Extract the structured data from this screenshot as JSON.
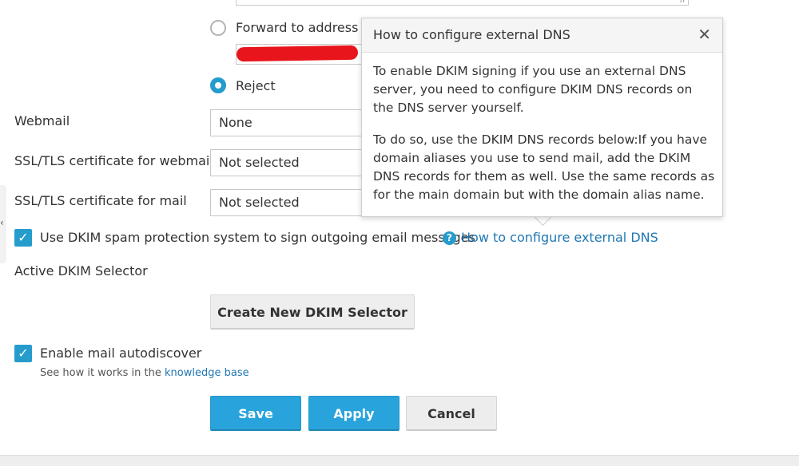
{
  "mail_forwarding": {
    "forward_label": "Forward to address",
    "reject_label": "Reject",
    "selected": "reject"
  },
  "fields": {
    "webmail_label": "Webmail",
    "webmail_value": "None",
    "ssl_webmail_label": "SSL/TLS certificate for webmail",
    "ssl_webmail_value": "Not selected",
    "ssl_mail_label": "SSL/TLS certificate for mail",
    "ssl_mail_value": "Not selected"
  },
  "dkim": {
    "checkbox_label": "Use DKIM spam protection system to sign outgoing email messages",
    "checked": true,
    "help_icon": "question-circle-icon",
    "help_link": "How to configure external DNS",
    "selector_label": "Active DKIM Selector",
    "create_button": "Create New DKIM Selector"
  },
  "autodiscover": {
    "checkbox_label": "Enable mail autodiscover",
    "checked": true,
    "hint_prefix": "See how it works in the",
    "hint_link": "knowledge base"
  },
  "actions": {
    "save": "Save",
    "apply": "Apply",
    "cancel": "Cancel"
  },
  "tooltip": {
    "title": "How to configure external DNS",
    "close_icon": "close-icon",
    "paragraph1": "To enable DKIM signing if you use an external DNS server, you need to configure DKIM DNS records on the DNS server yourself.",
    "paragraph2": "To do so, use the DKIM DNS records below:If you have domain aliases you use to send mail, add the DKIM DNS records for them as well. Use the same records as for the main domain but with the domain alias name."
  },
  "colors": {
    "accent": "#259ccc",
    "primary_button": "#29a3db",
    "link": "#1f77b4",
    "redaction": "#e8151c"
  }
}
